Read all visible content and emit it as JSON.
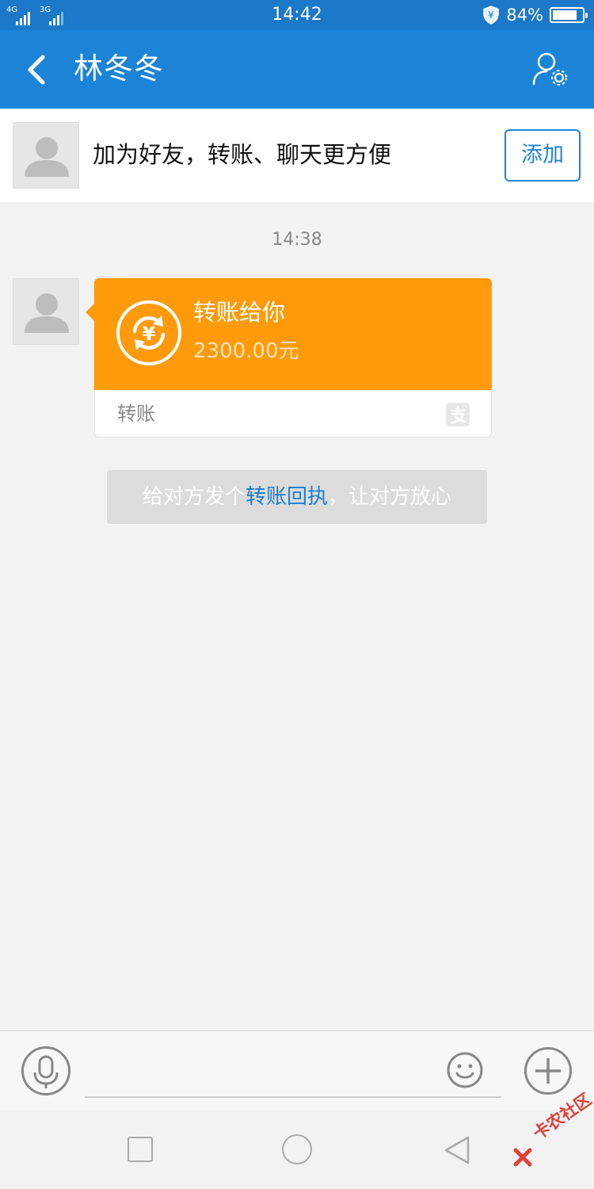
{
  "status_bar": {
    "net1": "4G",
    "net2": "3G",
    "time": "14:42",
    "battery_pct": "84%",
    "battery_level": 0.84,
    "shield_icon": "shield-yen-icon"
  },
  "header": {
    "back_icon": "chevron-left-icon",
    "title": "林冬冬",
    "settings_icon": "user-settings-icon",
    "accent_color": "#1c84d6"
  },
  "add_friend_bar": {
    "prompt": "加为好友，转账、聊天更方便",
    "add_label": "添加"
  },
  "chat": {
    "timestamp": "14:38",
    "transfer_card": {
      "icon": "yen-exchange-icon",
      "title": "转账给你",
      "amount": "2300.00元",
      "footer_label": "转账",
      "footer_icon": "alipay-icon",
      "color": "#ff9a0b"
    },
    "receipt_tip": {
      "before": "给对方发个",
      "link": "转账回执",
      "after": "，让对方放心"
    }
  },
  "input_bar": {
    "voice_icon": "microphone-icon",
    "placeholder": "",
    "emoji_icon": "smiley-icon",
    "plus_icon": "plus-icon"
  },
  "nav_keys": {
    "recent_icon": "square-icon",
    "home_icon": "circle-icon",
    "back_icon": "triangle-back-icon"
  },
  "watermark": {
    "text": "卡农社区"
  }
}
